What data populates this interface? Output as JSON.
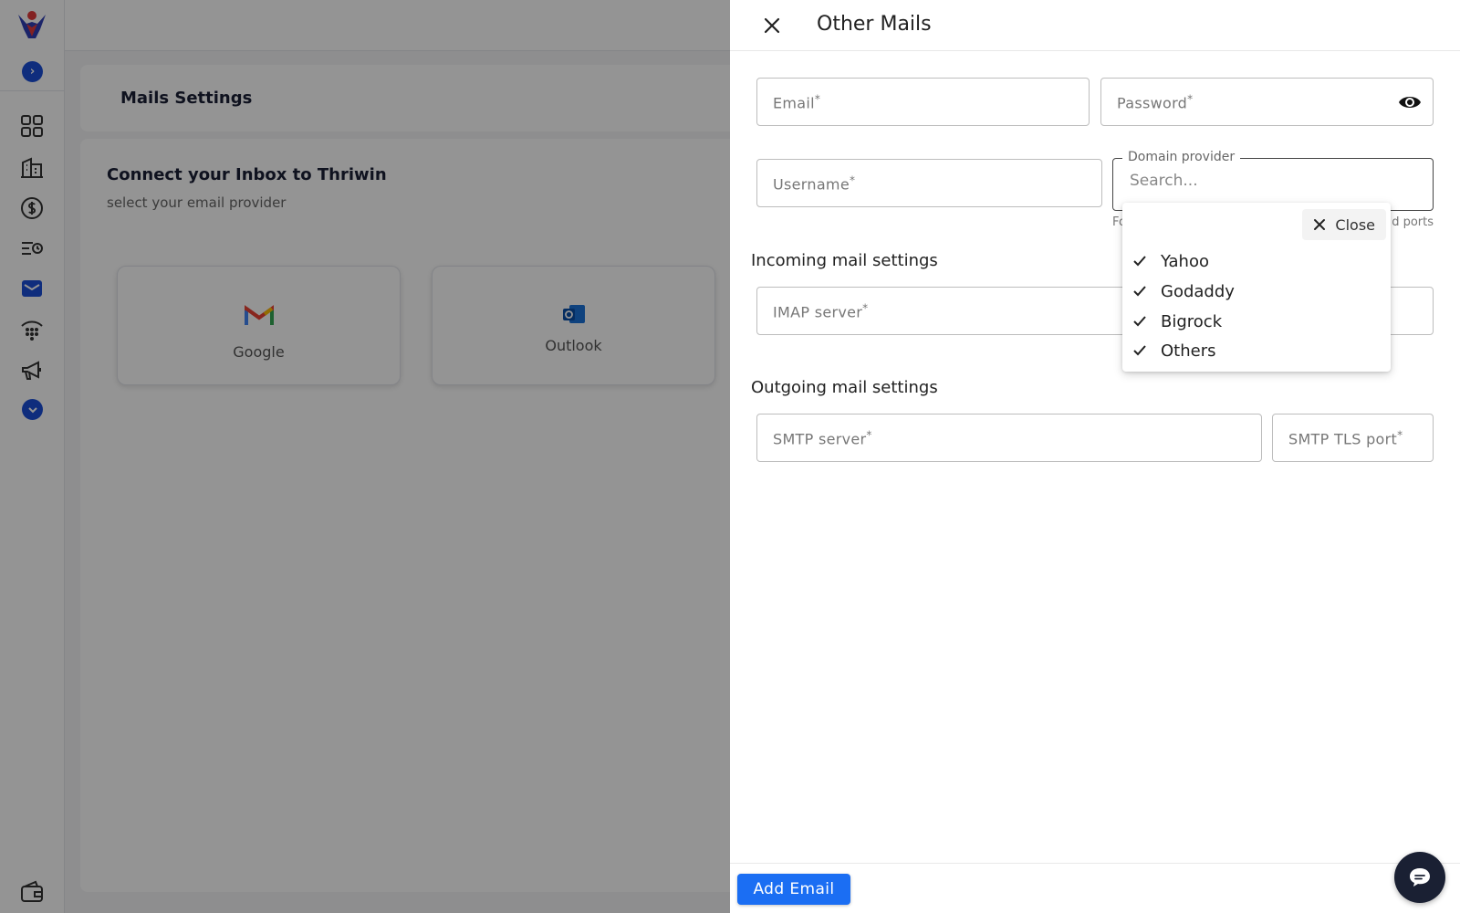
{
  "drawer": {
    "title": "Other Mails",
    "email_label": "Email",
    "password_label": "Password",
    "username_label": "Username",
    "required_mark": "*",
    "domain_legend": "Domain provider",
    "domain_search_placeholder": "Search...",
    "helper_left": "Fo",
    "helper_right": "d ports",
    "incoming_title": "Incoming mail settings",
    "imap_label": "IMAP server",
    "outgoing_title": "Outgoing mail settings",
    "smtp_label": "SMTP server",
    "smtp_port_label": "SMTP TLS port",
    "add_button": "Add Email"
  },
  "dropdown": {
    "close_label": "Close",
    "options": [
      "Yahoo",
      "Godaddy",
      "Bigrock",
      "Others"
    ]
  },
  "background": {
    "settings_title": "Mails Settings",
    "connect_title": "Connect your Inbox to Thriwin",
    "connect_subtitle": "select your email provider",
    "providers": [
      "Google",
      "Outlook"
    ]
  },
  "icons": {
    "close": "close-icon",
    "eye": "eye-icon",
    "check": "check-icon",
    "chat": "chat-icon"
  },
  "colors": {
    "primary": "#1b6ef3",
    "sidebar_accent": "#1b4fd8",
    "chat_bg": "#1a2033"
  }
}
